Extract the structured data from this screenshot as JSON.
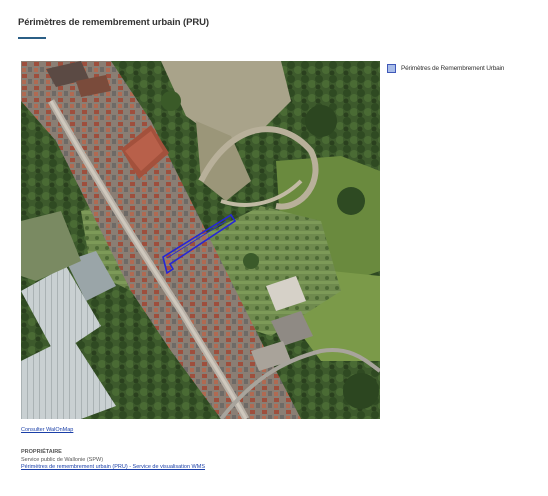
{
  "page": {
    "title": "Périmètres de remembrement urbain (PRU)"
  },
  "legend": {
    "label": "Périmètres de Remembrement Urbain",
    "swatch_color": "#a9bde8",
    "border_color": "#3f58b8"
  },
  "links": {
    "walonmap": "Consulter WalOnMap"
  },
  "owner": {
    "heading": "PROPRIÉTAIRE",
    "name": "Service public de Wallonie (SPW)",
    "service_link": "Périmètres de remembrement urbain (PRU) - Service de visualisation WMS"
  },
  "map": {
    "type": "aerial-photo",
    "perimeter_color": "#2626d6"
  }
}
